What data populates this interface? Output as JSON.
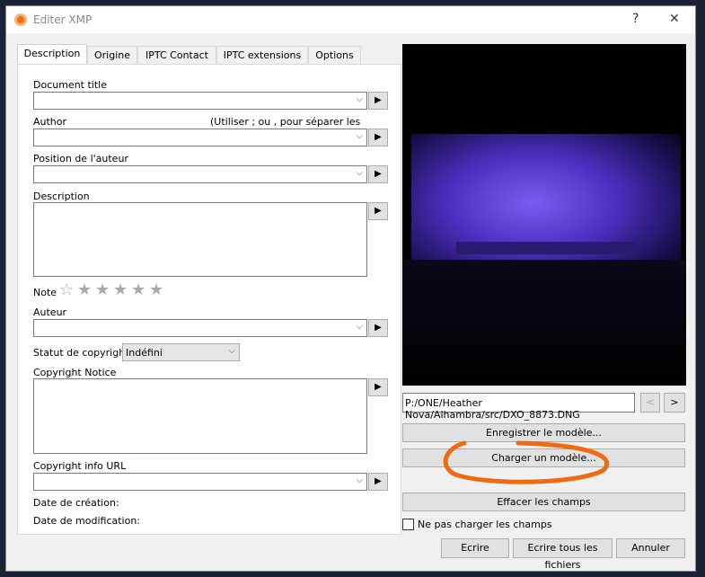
{
  "window": {
    "title": "Editer XMP",
    "help": "?",
    "close": "✕"
  },
  "tabs": [
    "Description",
    "Origine",
    "IPTC Contact",
    "IPTC extensions",
    "Options"
  ],
  "fields": {
    "document_title": "Document title",
    "author": "Author",
    "author_hint": "(Utiliser ; ou , pour séparer les valeurs)",
    "author_position": "Position de l'auteur",
    "description": "Description",
    "rating": "Note",
    "auteur": "Auteur",
    "copyright_status": "Statut de copyright",
    "copyright_status_value": "Indéfini",
    "copyright_notice": "Copyright Notice",
    "copyright_url": "Copyright info URL",
    "created": "Date de création:",
    "modified": "Date de modification:"
  },
  "stars": [
    "",
    "1",
    "2",
    "3",
    "4",
    "5"
  ],
  "path": "P:/ONE/Heather Nova/Alhambra/src/DXO_8873.DNG",
  "buttons": {
    "prev": "<",
    "next": ">",
    "save_template": "Enregistrer le modèle...",
    "load_template": "Charger un modèle...",
    "clear": "Effacer les champs",
    "write": "Ecrire",
    "write_all": "Ecrire tous les fichiers",
    "cancel": "Annuler"
  },
  "checkbox": {
    "label": "Ne pas charger les champs",
    "checked": false
  },
  "colors": {
    "annotation": "#f06a10",
    "photo_stage": "#5a3cd8"
  }
}
